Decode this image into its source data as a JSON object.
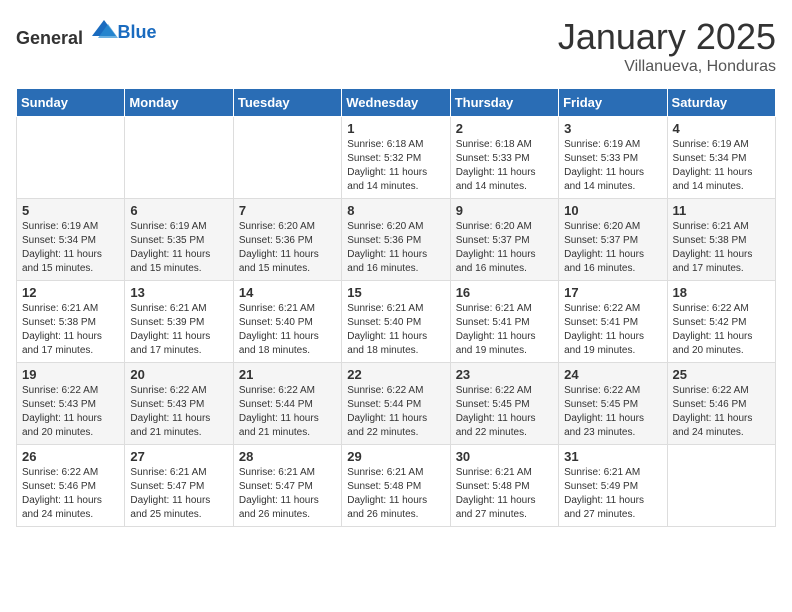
{
  "logo": {
    "general": "General",
    "blue": "Blue"
  },
  "title": "January 2025",
  "location": "Villanueva, Honduras",
  "days_of_week": [
    "Sunday",
    "Monday",
    "Tuesday",
    "Wednesday",
    "Thursday",
    "Friday",
    "Saturday"
  ],
  "weeks": [
    [
      {
        "day": "",
        "info": ""
      },
      {
        "day": "",
        "info": ""
      },
      {
        "day": "",
        "info": ""
      },
      {
        "day": "1",
        "info": "Sunrise: 6:18 AM\nSunset: 5:32 PM\nDaylight: 11 hours\nand 14 minutes."
      },
      {
        "day": "2",
        "info": "Sunrise: 6:18 AM\nSunset: 5:33 PM\nDaylight: 11 hours\nand 14 minutes."
      },
      {
        "day": "3",
        "info": "Sunrise: 6:19 AM\nSunset: 5:33 PM\nDaylight: 11 hours\nand 14 minutes."
      },
      {
        "day": "4",
        "info": "Sunrise: 6:19 AM\nSunset: 5:34 PM\nDaylight: 11 hours\nand 14 minutes."
      }
    ],
    [
      {
        "day": "5",
        "info": "Sunrise: 6:19 AM\nSunset: 5:34 PM\nDaylight: 11 hours\nand 15 minutes."
      },
      {
        "day": "6",
        "info": "Sunrise: 6:19 AM\nSunset: 5:35 PM\nDaylight: 11 hours\nand 15 minutes."
      },
      {
        "day": "7",
        "info": "Sunrise: 6:20 AM\nSunset: 5:36 PM\nDaylight: 11 hours\nand 15 minutes."
      },
      {
        "day": "8",
        "info": "Sunrise: 6:20 AM\nSunset: 5:36 PM\nDaylight: 11 hours\nand 16 minutes."
      },
      {
        "day": "9",
        "info": "Sunrise: 6:20 AM\nSunset: 5:37 PM\nDaylight: 11 hours\nand 16 minutes."
      },
      {
        "day": "10",
        "info": "Sunrise: 6:20 AM\nSunset: 5:37 PM\nDaylight: 11 hours\nand 16 minutes."
      },
      {
        "day": "11",
        "info": "Sunrise: 6:21 AM\nSunset: 5:38 PM\nDaylight: 11 hours\nand 17 minutes."
      }
    ],
    [
      {
        "day": "12",
        "info": "Sunrise: 6:21 AM\nSunset: 5:38 PM\nDaylight: 11 hours\nand 17 minutes."
      },
      {
        "day": "13",
        "info": "Sunrise: 6:21 AM\nSunset: 5:39 PM\nDaylight: 11 hours\nand 17 minutes."
      },
      {
        "day": "14",
        "info": "Sunrise: 6:21 AM\nSunset: 5:40 PM\nDaylight: 11 hours\nand 18 minutes."
      },
      {
        "day": "15",
        "info": "Sunrise: 6:21 AM\nSunset: 5:40 PM\nDaylight: 11 hours\nand 18 minutes."
      },
      {
        "day": "16",
        "info": "Sunrise: 6:21 AM\nSunset: 5:41 PM\nDaylight: 11 hours\nand 19 minutes."
      },
      {
        "day": "17",
        "info": "Sunrise: 6:22 AM\nSunset: 5:41 PM\nDaylight: 11 hours\nand 19 minutes."
      },
      {
        "day": "18",
        "info": "Sunrise: 6:22 AM\nSunset: 5:42 PM\nDaylight: 11 hours\nand 20 minutes."
      }
    ],
    [
      {
        "day": "19",
        "info": "Sunrise: 6:22 AM\nSunset: 5:43 PM\nDaylight: 11 hours\nand 20 minutes."
      },
      {
        "day": "20",
        "info": "Sunrise: 6:22 AM\nSunset: 5:43 PM\nDaylight: 11 hours\nand 21 minutes."
      },
      {
        "day": "21",
        "info": "Sunrise: 6:22 AM\nSunset: 5:44 PM\nDaylight: 11 hours\nand 21 minutes."
      },
      {
        "day": "22",
        "info": "Sunrise: 6:22 AM\nSunset: 5:44 PM\nDaylight: 11 hours\nand 22 minutes."
      },
      {
        "day": "23",
        "info": "Sunrise: 6:22 AM\nSunset: 5:45 PM\nDaylight: 11 hours\nand 22 minutes."
      },
      {
        "day": "24",
        "info": "Sunrise: 6:22 AM\nSunset: 5:45 PM\nDaylight: 11 hours\nand 23 minutes."
      },
      {
        "day": "25",
        "info": "Sunrise: 6:22 AM\nSunset: 5:46 PM\nDaylight: 11 hours\nand 24 minutes."
      }
    ],
    [
      {
        "day": "26",
        "info": "Sunrise: 6:22 AM\nSunset: 5:46 PM\nDaylight: 11 hours\nand 24 minutes."
      },
      {
        "day": "27",
        "info": "Sunrise: 6:21 AM\nSunset: 5:47 PM\nDaylight: 11 hours\nand 25 minutes."
      },
      {
        "day": "28",
        "info": "Sunrise: 6:21 AM\nSunset: 5:47 PM\nDaylight: 11 hours\nand 26 minutes."
      },
      {
        "day": "29",
        "info": "Sunrise: 6:21 AM\nSunset: 5:48 PM\nDaylight: 11 hours\nand 26 minutes."
      },
      {
        "day": "30",
        "info": "Sunrise: 6:21 AM\nSunset: 5:48 PM\nDaylight: 11 hours\nand 27 minutes."
      },
      {
        "day": "31",
        "info": "Sunrise: 6:21 AM\nSunset: 5:49 PM\nDaylight: 11 hours\nand 27 minutes."
      },
      {
        "day": "",
        "info": ""
      }
    ]
  ]
}
